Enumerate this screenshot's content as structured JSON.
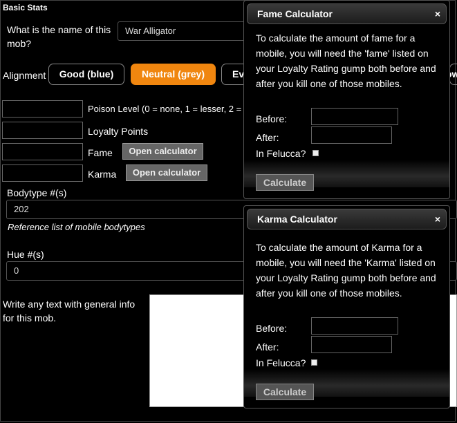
{
  "section": {
    "title": "Basic Stats"
  },
  "mob_name": {
    "question": "What is the name of this mob?",
    "value": "War Alligator"
  },
  "alignment": {
    "label": "Alignment",
    "options": [
      "Good (blue)",
      "Neutral (grey)",
      "Evil (red)"
    ],
    "selected": "Neutral (grey)",
    "partial_labels": [
      "Ev",
      "ow"
    ]
  },
  "stats": {
    "poison_label": "Poison Level (0 = none, 1 = lesser, 2 =",
    "loyalty_label": "Loyalty Points",
    "fame_label": "Fame",
    "karma_label": "Karma",
    "open_calculator": "Open calculator"
  },
  "bodytype": {
    "label": "Bodytype #(s)",
    "value": "202",
    "link": "Reference list of mobile bodytypes"
  },
  "hue": {
    "label": "Hue #(s)",
    "value": "0"
  },
  "general_info": {
    "label": "Write any text with general info for this mob."
  },
  "fame_dialog": {
    "title": "Fame Calculator",
    "close": "×",
    "description": "To calculate the amount of fame for a mobile, you will need the 'fame' listed on your Loyalty Rating gump both before and after you kill one of those mobiles.",
    "before_label": "Before:",
    "after_label": "After:",
    "felucca_label": "In Felucca?",
    "calculate": "Calculate"
  },
  "karma_dialog": {
    "title": "Karma Calculator",
    "close": "×",
    "description": "To calculate the amount of Karma for a mobile, you will need the 'Karma' listed on your Loyalty Rating gump both before and after you kill one of those mobiles.",
    "before_label": "Before:",
    "after_label": "After:",
    "felucca_label": "In Felucca?",
    "calculate": "Calculate"
  },
  "colors": {
    "active_button": "#f0860f",
    "background": "#000000"
  }
}
